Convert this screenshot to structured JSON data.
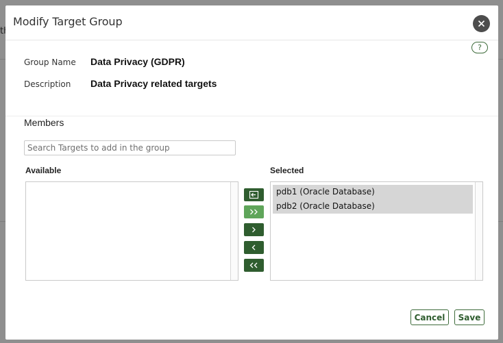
{
  "background": {
    "fragment": "th"
  },
  "dialog": {
    "title": "Modify Target Group",
    "help_label": "?"
  },
  "group": {
    "name_label": "Group Name",
    "name_value": "Data Privacy (GDPR)",
    "description_label": "Description",
    "description_value": "Data Privacy related targets"
  },
  "members": {
    "title": "Members",
    "search_placeholder": "Search Targets to add in the group",
    "available_label": "Available",
    "selected_label": "Selected",
    "available_items": [],
    "selected_items": [
      "pdb1 (Oracle Database)",
      "pdb2 (Oracle Database)"
    ]
  },
  "footer": {
    "cancel_label": "Cancel",
    "save_label": "Save"
  },
  "colors": {
    "accent_dark": "#2f5d2f",
    "accent_light": "#5fa55a",
    "overlay": "#8f8f8f"
  }
}
